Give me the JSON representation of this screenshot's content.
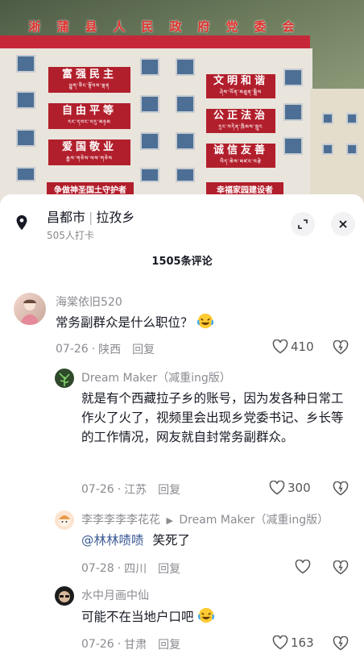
{
  "photo": {
    "roof_sign": [
      "淅",
      "蒲",
      "县",
      "人",
      "民",
      "政",
      "府",
      "党",
      "委",
      "会"
    ],
    "plates_left": [
      {
        "big": "富强民主",
        "small": "ཕྱུག་ཅིང་སྟོབས་ལྡན"
      },
      {
        "big": "自由平等",
        "small": "རང་དབང་འདྲ་མཉམ"
      },
      {
        "big": "爱国敬业",
        "small": "རྒྱལ་གཅེས་ལས་གཅེས"
      }
    ],
    "plates_right": [
      {
        "big": "文明和谐",
        "small": "ཤེས་ཡོན་མཐུན་སྒྲིལ"
      },
      {
        "big": "公正法治",
        "small": "དྲང་བདེན་ཁྲིམས་སྲུང"
      },
      {
        "big": "诚信友善",
        "small": "ཡིད་ཆེས་མཛའ་བརྩེ"
      }
    ],
    "banner_left": "争做神圣国土守护者",
    "banner_right": "幸福家园建设者"
  },
  "header": {
    "location_main": "昌都市",
    "location_sep": "|",
    "location_sub": "拉孜乡",
    "checkins": "505人打卡",
    "comment_count": "1505条评论"
  },
  "colors": {
    "mention": "#3a5a94",
    "muted": "#8a8b91",
    "text": "#161823",
    "banner_red": "#b21f2c"
  },
  "comments": [
    {
      "user": "海棠依旧520",
      "text": "常务副群众是什么职位？",
      "emoji": "laughing-crying-icon",
      "date": "07-26",
      "region": "陕西",
      "reply_label": "回复",
      "likes": "410"
    },
    {
      "user": "Dream Maker（减重ing版）",
      "text": "就是有个西藏拉子乡的账号，因为发各种日常工作火了火了，视频里会出现乡党委书记、乡长等的工作情况，网友就自封常务副群众。",
      "date": "07-26",
      "region": "江苏",
      "reply_label": "回复",
      "likes": "300"
    },
    {
      "user": "李李李李李花花",
      "reply_arrow": "▶",
      "reply_to": "Dream Maker（减重ing版）",
      "mention": "@林林啧啧",
      "text": "笑死了",
      "date": "07-28",
      "region": "四川",
      "reply_label": "回复",
      "likes": ""
    },
    {
      "user": "水中月画中仙",
      "text": "可能不在当地户口吧",
      "emoji": "laughing-crying-icon",
      "date": "07-26",
      "region": "甘肃",
      "reply_label": "回复",
      "likes": "163"
    }
  ],
  "meta_sep": "·"
}
